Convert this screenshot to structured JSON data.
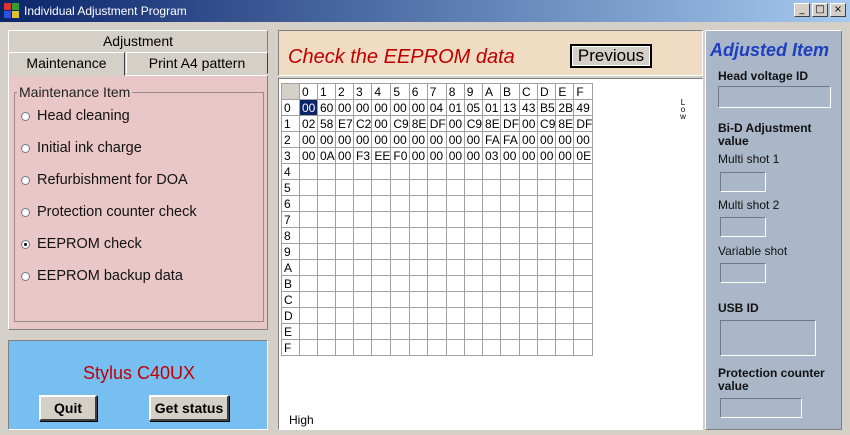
{
  "window": {
    "title": "Individual Adjustment Program",
    "controls": [
      "_",
      "□",
      "×"
    ]
  },
  "left": {
    "adjustment_label": "Adjustment",
    "tabs": [
      {
        "label": "Maintenance",
        "active": true
      },
      {
        "label": "Print A4 pattern",
        "active": false
      }
    ],
    "group_title": "Maintenance Item",
    "items": [
      {
        "label": "Head cleaning",
        "checked": false
      },
      {
        "label": "Initial ink charge",
        "checked": false
      },
      {
        "label": "Refurbishment for DOA",
        "checked": false
      },
      {
        "label": "Protection counter check",
        "checked": false
      },
      {
        "label": "EEPROM check",
        "checked": true
      },
      {
        "label": "EEPROM backup data",
        "checked": false
      }
    ],
    "model_name": "Stylus C40UX",
    "quit_label": "Quit",
    "status_label": "Get status"
  },
  "middle": {
    "title": "Check the EEPROM data",
    "previous_label": "Previous",
    "low_label": "Low",
    "high_label": "High",
    "columns": [
      "0",
      "1",
      "2",
      "3",
      "4",
      "5",
      "6",
      "7",
      "8",
      "9",
      "A",
      "B",
      "C",
      "D",
      "E",
      "F"
    ],
    "rows": [
      {
        "label": "0",
        "cells": [
          "00",
          "60",
          "00",
          "00",
          "00",
          "00",
          "00",
          "04",
          "01",
          "05",
          "01",
          "13",
          "43",
          "B5",
          "2B",
          "49"
        ]
      },
      {
        "label": "1",
        "cells": [
          "02",
          "58",
          "E7",
          "C2",
          "00",
          "C9",
          "8E",
          "DF",
          "00",
          "C9",
          "8E",
          "DF",
          "00",
          "C9",
          "8E",
          "DF"
        ]
      },
      {
        "label": "2",
        "cells": [
          "00",
          "00",
          "00",
          "00",
          "00",
          "00",
          "00",
          "00",
          "00",
          "00",
          "FA",
          "FA",
          "00",
          "00",
          "00",
          "00"
        ]
      },
      {
        "label": "3",
        "cells": [
          "00",
          "0A",
          "00",
          "F3",
          "EE",
          "F0",
          "00",
          "00",
          "00",
          "00",
          "03",
          "00",
          "00",
          "00",
          "00",
          "0E"
        ]
      },
      {
        "label": "4",
        "cells": [
          "",
          "",
          "",
          "",
          "",
          "",
          "",
          "",
          "",
          "",
          "",
          "",
          "",
          "",
          "",
          ""
        ]
      },
      {
        "label": "5",
        "cells": [
          "",
          "",
          "",
          "",
          "",
          "",
          "",
          "",
          "",
          "",
          "",
          "",
          "",
          "",
          "",
          ""
        ]
      },
      {
        "label": "6",
        "cells": [
          "",
          "",
          "",
          "",
          "",
          "",
          "",
          "",
          "",
          "",
          "",
          "",
          "",
          "",
          "",
          ""
        ]
      },
      {
        "label": "7",
        "cells": [
          "",
          "",
          "",
          "",
          "",
          "",
          "",
          "",
          "",
          "",
          "",
          "",
          "",
          "",
          "",
          ""
        ]
      },
      {
        "label": "8",
        "cells": [
          "",
          "",
          "",
          "",
          "",
          "",
          "",
          "",
          "",
          "",
          "",
          "",
          "",
          "",
          "",
          ""
        ]
      },
      {
        "label": "9",
        "cells": [
          "",
          "",
          "",
          "",
          "",
          "",
          "",
          "",
          "",
          "",
          "",
          "",
          "",
          "",
          "",
          ""
        ]
      },
      {
        "label": "A",
        "cells": [
          "",
          "",
          "",
          "",
          "",
          "",
          "",
          "",
          "",
          "",
          "",
          "",
          "",
          "",
          "",
          ""
        ]
      },
      {
        "label": "B",
        "cells": [
          "",
          "",
          "",
          "",
          "",
          "",
          "",
          "",
          "",
          "",
          "",
          "",
          "",
          "",
          "",
          ""
        ]
      },
      {
        "label": "C",
        "cells": [
          "",
          "",
          "",
          "",
          "",
          "",
          "",
          "",
          "",
          "",
          "",
          "",
          "",
          "",
          "",
          ""
        ]
      },
      {
        "label": "D",
        "cells": [
          "",
          "",
          "",
          "",
          "",
          "",
          "",
          "",
          "",
          "",
          "",
          "",
          "",
          "",
          "",
          ""
        ]
      },
      {
        "label": "E",
        "cells": [
          "",
          "",
          "",
          "",
          "",
          "",
          "",
          "",
          "",
          "",
          "",
          "",
          "",
          "",
          "",
          ""
        ]
      },
      {
        "label": "F",
        "cells": [
          "",
          "",
          "",
          "",
          "",
          "",
          "",
          "",
          "",
          "",
          "",
          "",
          "",
          "",
          "",
          ""
        ]
      }
    ],
    "selected_cell": {
      "row": 0,
      "col": 0
    }
  },
  "right": {
    "title": "Adjusted Item",
    "head_voltage_label": "Head voltage ID",
    "bid_label": "Bi-D Adjustment value",
    "multi1_label": "Multi shot 1",
    "multi2_label": "Multi shot 2",
    "variable_label": "Variable shot",
    "usb_label": "USB ID",
    "protection_label": "Protection counter value"
  },
  "colors": {
    "maintenance_bg": "#e9c7c9",
    "model_bg": "#77bff0",
    "header_bg": "#efdcc2",
    "right_bg": "#a9b7c9",
    "accent_red": "#c00000",
    "accent_blue": "#1f3fbf"
  },
  "icons": {
    "app": "app-icon"
  }
}
